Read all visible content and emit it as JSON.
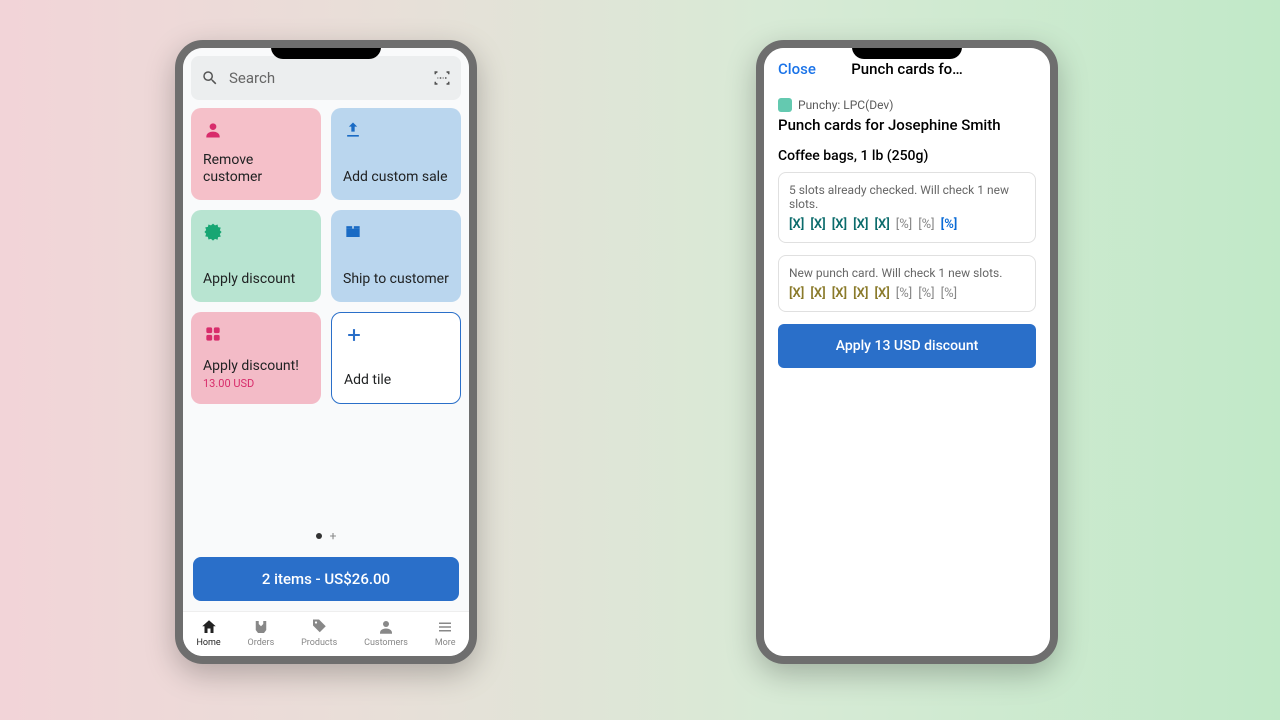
{
  "phone1": {
    "search": {
      "placeholder": "Search"
    },
    "tiles": {
      "remove_customer": "Remove customer",
      "add_custom_sale": "Add custom sale",
      "apply_discount": "Apply discount",
      "ship_to_customer": "Ship to customer",
      "apply_discount_bang": "Apply discount!",
      "apply_discount_amount": "13.00 USD",
      "add_tile": "Add tile"
    },
    "cart": "2 items - US$26.00",
    "tabs": {
      "home": "Home",
      "orders": "Orders",
      "products": "Products",
      "customers": "Customers",
      "more": "More"
    }
  },
  "phone2": {
    "close": "Close",
    "header_title": "Punch cards fo…",
    "app_label": "Punchy: LPC(Dev)",
    "title": "Punch cards for Josephine Smith",
    "product": "Coffee bags, 1 lb (250g)",
    "card1": {
      "text": "5 slots already checked. Will check 1 new slots.",
      "slots": [
        "[X]",
        "[X]",
        "[X]",
        "[X]",
        "[X]",
        "[%]",
        "[%]",
        "[%]"
      ],
      "styles": [
        "dk",
        "dk",
        "dk",
        "dk",
        "dk",
        "gr",
        "gr",
        "bl"
      ]
    },
    "card2": {
      "text": "New punch card. Will check 1 new slots.",
      "slots": [
        "[X]",
        "[X]",
        "[X]",
        "[X]",
        "[X]",
        "[%]",
        "[%]",
        "[%]"
      ],
      "styles": [
        "ol",
        "ol",
        "ol",
        "ol",
        "ol",
        "gr",
        "gr",
        "gr"
      ]
    },
    "apply": "Apply 13 USD discount"
  }
}
